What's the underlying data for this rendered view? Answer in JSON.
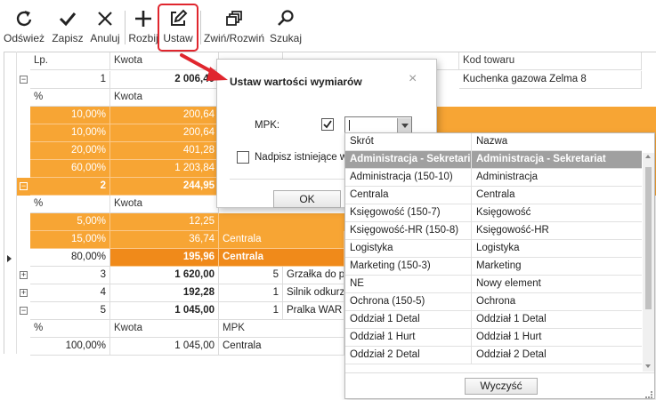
{
  "toolbar": {
    "buttons": [
      {
        "label": "Odśwież",
        "icon": "refresh-icon"
      },
      {
        "label": "Zapisz",
        "icon": "checkmark-icon"
      },
      {
        "label": "Anuluj",
        "icon": "close-icon"
      },
      {
        "label": "Rozbij",
        "icon": "plus-icon"
      },
      {
        "label": "Ustaw",
        "icon": "edit-icon"
      },
      {
        "label": "Zwiń/Rozwiń",
        "icon": "collapse-expand-icon"
      },
      {
        "label": "Szukaj",
        "icon": "search-icon"
      }
    ],
    "highlight_color": "#e0262e"
  },
  "grid": {
    "columns": [
      "Lp.",
      "Kwota",
      "Kod towaru"
    ],
    "rows": [
      {
        "lp": "1",
        "kwota": "2 006,40",
        "kod": "Kuchenka gazowa Zelma 8"
      },
      {
        "lp": "2",
        "kwota": "244,95"
      },
      {
        "lp": "3",
        "kwota": "1 620,00",
        "qty": "5",
        "name": "Grzałka do pr"
      },
      {
        "lp": "4",
        "kwota": "192,28",
        "qty": "1",
        "name": "Silnik odkurz"
      },
      {
        "lp": "5",
        "kwota": "1 045,00",
        "qty": "1",
        "name": "Pralka WAR s"
      }
    ],
    "sub1": {
      "headers": [
        "%",
        "Kwota"
      ],
      "rows": [
        {
          "pct": "10,00%",
          "amt": "200,64"
        },
        {
          "pct": "10,00%",
          "amt": "200,64"
        },
        {
          "pct": "20,00%",
          "amt": "401,28"
        },
        {
          "pct": "60,00%",
          "amt": "1 203,84"
        }
      ]
    },
    "sub2": {
      "headers": [
        "%",
        "Kwota"
      ],
      "rows": [
        {
          "pct": "5,00%",
          "amt": "12,25",
          "mpk": ""
        },
        {
          "pct": "15,00%",
          "amt": "36,74",
          "mpk": "Centrala"
        },
        {
          "pct": "80,00%",
          "amt": "195,96",
          "mpk": "Centrala"
        }
      ]
    },
    "sub5": {
      "headers": [
        "%",
        "Kwota",
        "MPK"
      ],
      "rows": [
        {
          "pct": "100,00%",
          "amt": "1 045,00",
          "mpk": "Centrala"
        }
      ]
    },
    "colors": {
      "orange": "#f7a534",
      "dark_orange": "#f08a1a"
    }
  },
  "dialog": {
    "title": "Ustaw wartości wymiarów",
    "close": "×",
    "mpk_label": "MPK:",
    "mpk_checked": true,
    "mpk_value": "",
    "overwrite_label": "Nadpisz istniejące wa",
    "overwrite_checked": false,
    "ok_label": "OK"
  },
  "dropdown": {
    "headers": [
      "Skrót",
      "Nazwa"
    ],
    "selected_index": 0,
    "items": [
      {
        "code": "Administracja - Sekretari...",
        "name": "Administracja - Sekretariat"
      },
      {
        "code": "Administracja (150-10)",
        "name": "Administracja"
      },
      {
        "code": "Centrala",
        "name": "Centrala"
      },
      {
        "code": "Księgowość (150-7)",
        "name": "Księgowość"
      },
      {
        "code": "Księgowość-HR (150-8)",
        "name": "Księgowość-HR"
      },
      {
        "code": "Logistyka",
        "name": "Logistyka"
      },
      {
        "code": "Marketing (150-3)",
        "name": "Marketing"
      },
      {
        "code": "NE",
        "name": "Nowy element"
      },
      {
        "code": "Ochrona (150-5)",
        "name": "Ochrona"
      },
      {
        "code": "Oddział 1 Detal",
        "name": "Oddział 1 Detal"
      },
      {
        "code": "Oddział 1 Hurt",
        "name": "Oddział 1 Hurt"
      },
      {
        "code": "Oddział 2 Detal",
        "name": "Oddział 2 Detal"
      }
    ],
    "clear_label": "Wyczyść"
  },
  "annotation_arrow_color": "#e0262e"
}
